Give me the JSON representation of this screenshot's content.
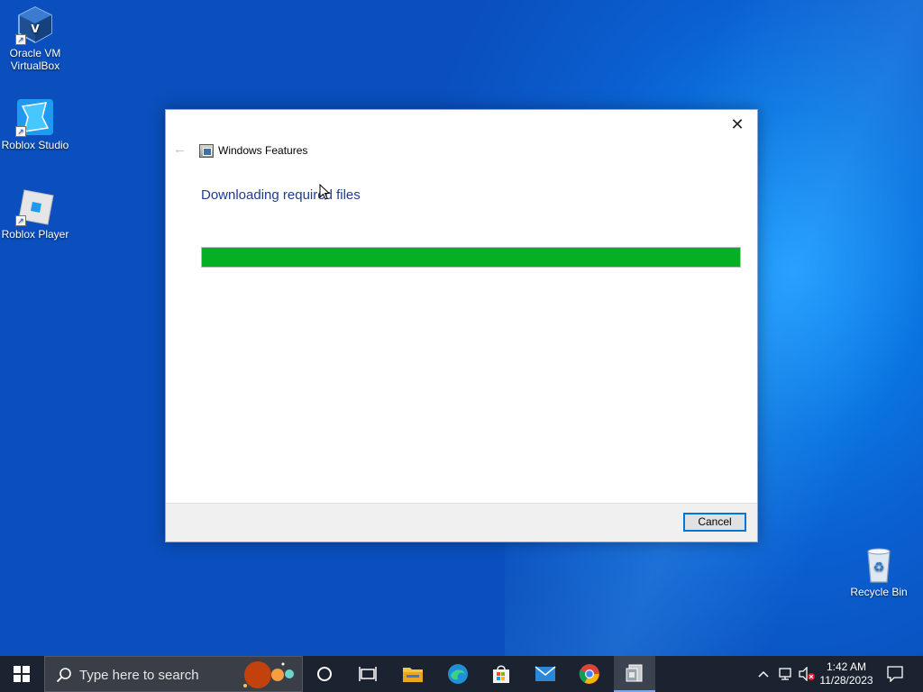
{
  "desktop": {
    "icons": [
      {
        "label": "Oracle VM VirtualBox",
        "icon": "virtualbox-icon"
      },
      {
        "label": "Roblox Studio",
        "icon": "roblox-studio-icon"
      },
      {
        "label": "Roblox Player",
        "icon": "roblox-player-icon"
      },
      {
        "label": "Recycle Bin",
        "icon": "recycle-bin-icon"
      }
    ]
  },
  "dialog": {
    "title": "Windows Features",
    "heading": "Downloading required files",
    "progress_fraction": 1.0,
    "progress_color": "#06b025",
    "cancel_label": "Cancel",
    "close_glyph": "✕",
    "back_glyph": "←"
  },
  "taskbar": {
    "search_placeholder": "Type here to search",
    "apps": [
      "task-view",
      "file-explorer",
      "edge",
      "microsoft-store",
      "mail",
      "chrome",
      "windows-features"
    ],
    "clock": {
      "time": "1:42 AM",
      "date": "11/28/2023"
    }
  }
}
